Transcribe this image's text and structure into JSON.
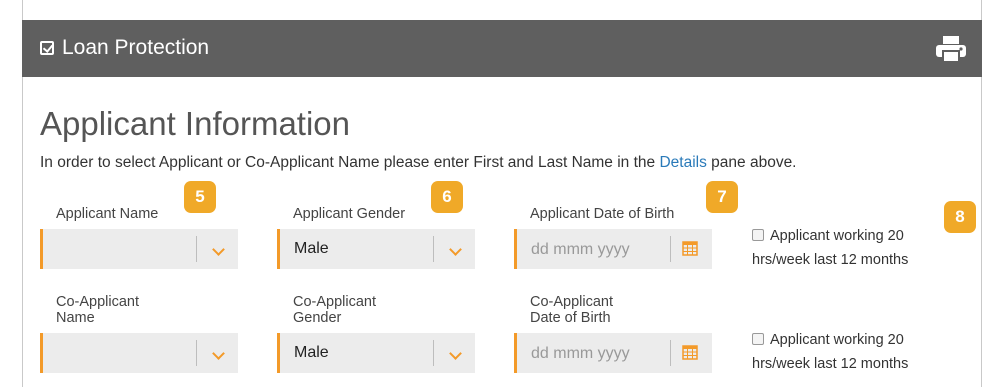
{
  "header": {
    "title": "Loan Protection",
    "check_icon": "checkbox-icon",
    "print_icon": "printer-icon",
    "bg_color": "#5f5f5f"
  },
  "section": {
    "heading": "Applicant Information",
    "intro_before": "In order to select Applicant or Co-Applicant Name please enter First and Last Name in the ",
    "intro_link": "Details",
    "intro_after": " pane above."
  },
  "badges": [
    "5",
    "6",
    "7",
    "8"
  ],
  "applicant": {
    "name_label": "Applicant Name",
    "name_value": "",
    "gender_label": "Applicant Gender",
    "gender_value": "Male",
    "dob_label": "Applicant Date of Birth",
    "dob_placeholder": "dd mmm yyyy",
    "working_line1": "Applicant working 20",
    "working_line2": "hrs/week last 12 months"
  },
  "co_applicant": {
    "name_label_line1": "Co-Applicant",
    "name_label_line2": "Name",
    "name_value": "",
    "gender_label_line1": "Co-Applicant",
    "gender_label_line2": "Gender",
    "gender_value": "Male",
    "dob_label_line1": "Co-Applicant",
    "dob_label_line2": "Date of Birth",
    "dob_placeholder": "dd mmm yyyy",
    "working_line1": "Applicant working 20",
    "working_line2": "hrs/week last 12 months"
  },
  "colors": {
    "accent": "#f39a29",
    "badge": "#f0a928",
    "link": "#2a7ab9",
    "field_bg": "#ececec"
  }
}
